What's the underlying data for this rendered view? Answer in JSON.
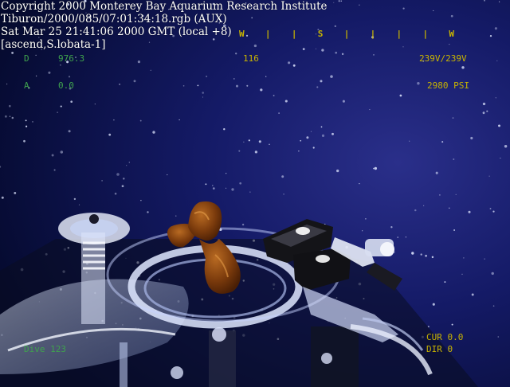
{
  "overlay": {
    "copyright": "Copyright 2000 Monterey Bay Aquarium Research Institute",
    "source": "Tiburon/2000/085/07:01:34:18.rgb (AUX)",
    "datetime": "Sat Mar 25 21:41:06 2000 GMT (local +8)",
    "tag": "[ascend,S.lobata-1]"
  },
  "hud": {
    "depth_label": "D",
    "depth_value": "976.3",
    "altitude_label": "A",
    "altitude_value": "0.0",
    "heading": "116",
    "voltage": "239V/239V",
    "pressure": "2980 PSI",
    "compass_marks": [
      "W",
      "|",
      "|",
      "S",
      "|",
      "|",
      "|",
      "|",
      "W"
    ],
    "dive": "Dive 123",
    "current": "CUR 0.0",
    "direction": "DIR 0"
  },
  "colors": {
    "overlay_text": "#ffffff",
    "hud_yellow": "#c8b400",
    "hud_green": "#3fa34d",
    "water": "#0c1550"
  }
}
